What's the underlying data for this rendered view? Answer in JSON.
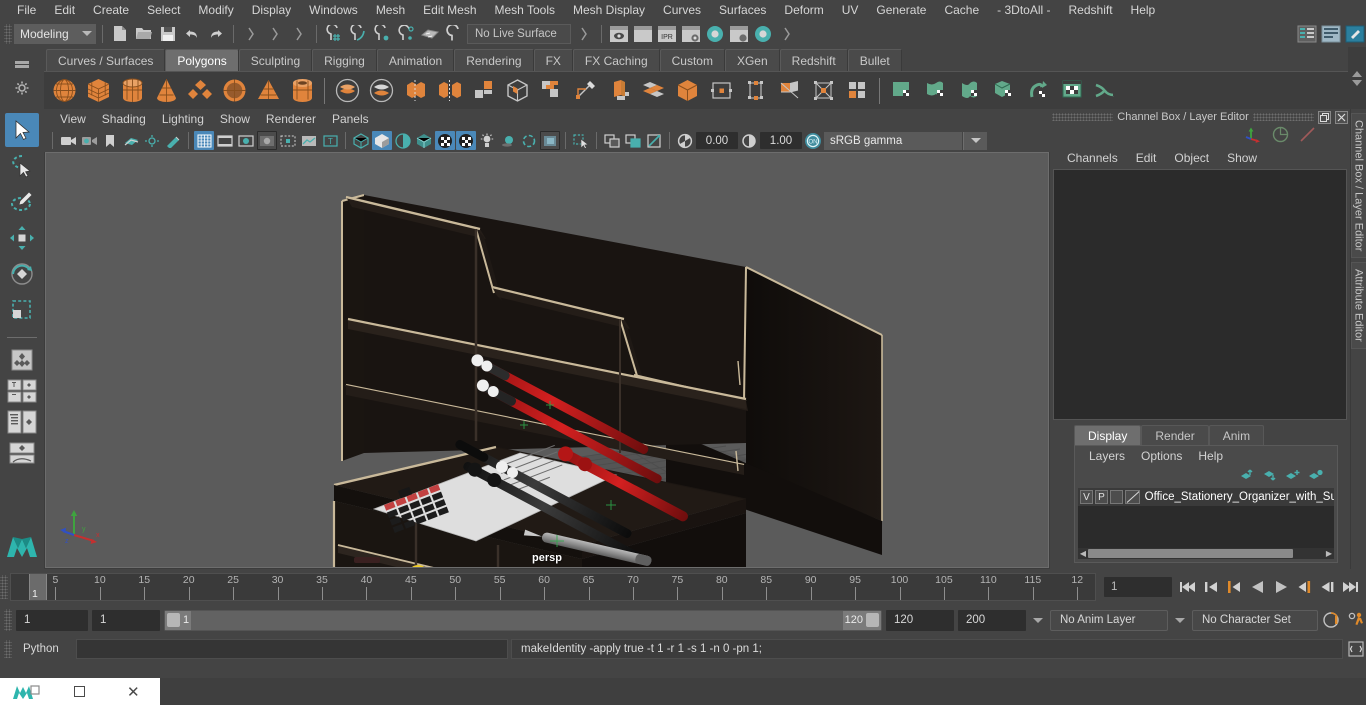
{
  "app": {
    "name": "Autodesk Maya",
    "menubar": [
      "File",
      "Edit",
      "Create",
      "Select",
      "Modify",
      "Display",
      "Windows",
      "Mesh",
      "Edit Mesh",
      "Mesh Tools",
      "Mesh Display",
      "Curves",
      "Surfaces",
      "Deform",
      "UV",
      "Generate",
      "Cache",
      "- 3DtoAll -",
      "Redshift",
      "Help"
    ]
  },
  "statusline": {
    "menuset": "Modeling",
    "live_surface": "No Live Surface",
    "icons": [
      "new-scene-icon",
      "open-scene-icon",
      "save-scene-icon",
      "undo-icon",
      "redo-icon",
      "select-by-hierarchy-icon",
      "select-by-object-icon",
      "select-by-component-icon",
      "snap-to-grid-icon",
      "snap-to-curve-icon",
      "snap-to-point-icon",
      "snap-to-projected-center-icon",
      "snap-to-view-plane-icon",
      "make-live-icon",
      "render-view-icon",
      "render-current-frame-icon",
      "ipr-render-icon",
      "render-settings-icon",
      "hypershade-icon",
      "render-setup-icon",
      "rendering-flags-icon"
    ]
  },
  "shelf": {
    "tabs": [
      "Curves / Surfaces",
      "Polygons",
      "Sculpting",
      "Rigging",
      "Animation",
      "Rendering",
      "FX",
      "FX Caching",
      "Custom",
      "XGen",
      "Redshift",
      "Bullet"
    ],
    "active_tab": "Polygons",
    "accent_orange": "#e0843c",
    "accent_green": "#62a98a",
    "items": [
      {
        "name": "poly-sphere-icon",
        "color": "orange"
      },
      {
        "name": "poly-cube-icon",
        "color": "orange"
      },
      {
        "name": "poly-cylinder-icon",
        "color": "orange"
      },
      {
        "name": "poly-cone-icon",
        "color": "orange"
      },
      {
        "name": "poly-plane-icon",
        "color": "orange"
      },
      {
        "name": "poly-torus-icon",
        "color": "orange"
      },
      {
        "name": "poly-pyramid-icon",
        "color": "orange"
      },
      {
        "name": "poly-pipe-icon",
        "color": "orange"
      },
      {
        "name": "boolean-union-icon",
        "color": "orange"
      },
      {
        "name": "boolean-difference-icon",
        "color": "orange"
      },
      {
        "name": "combine-icon",
        "color": "orange"
      },
      {
        "name": "separate-icon",
        "color": "orange"
      },
      {
        "name": "smooth-icon",
        "color": "gray"
      },
      {
        "name": "reduce-icon",
        "color": "gray"
      },
      {
        "name": "multi-cut-icon",
        "color": "gray"
      },
      {
        "name": "extrude-icon",
        "color": "orange"
      },
      {
        "name": "bevel-icon",
        "color": "gray"
      },
      {
        "name": "bridge-icon",
        "color": "orange"
      },
      {
        "name": "merge-icon",
        "color": "gray"
      },
      {
        "name": "append-polygon-icon",
        "color": "orange"
      },
      {
        "name": "wedge-icon",
        "color": "orange"
      },
      {
        "name": "poke-face-icon",
        "color": "orange"
      },
      {
        "name": "quad-draw-icon",
        "color": "gray"
      },
      {
        "name": "uv-editor-icon",
        "color": "green"
      },
      {
        "name": "uv-planar-icon",
        "color": "green"
      },
      {
        "name": "uv-cylindrical-icon",
        "color": "green"
      },
      {
        "name": "uv-automatic-icon",
        "color": "green"
      },
      {
        "name": "uv-unfold-icon",
        "color": "green"
      },
      {
        "name": "uv-layout-icon",
        "color": "green"
      },
      {
        "name": "uv-snapshot-icon",
        "color": "green"
      }
    ]
  },
  "toolbox": {
    "items": [
      {
        "name": "select-tool",
        "selected": true
      },
      {
        "name": "lasso-select-tool",
        "selected": false
      },
      {
        "name": "paint-select-tool",
        "selected": false
      },
      {
        "name": "move-tool",
        "selected": false
      },
      {
        "name": "rotate-tool",
        "selected": false
      },
      {
        "name": "scale-tool",
        "selected": false
      },
      {
        "name": "last-tool-used",
        "selected": false
      },
      {
        "name": "four-view-layout",
        "selected": false
      },
      {
        "name": "persp-outliner-layout",
        "selected": false
      },
      {
        "name": "persp-graph-layout",
        "selected": false
      },
      {
        "name": "maya-logo",
        "selected": false
      }
    ]
  },
  "viewport": {
    "menubar": [
      "View",
      "Shading",
      "Lighting",
      "Show",
      "Renderer",
      "Panels"
    ],
    "camera_label": "persp",
    "toolbar": {
      "exposure": "0.00",
      "gamma": "1.00",
      "color_management": "sRGB gamma",
      "icons": [
        "select-camera-icon",
        "camera-attributes-icon",
        "bookmark-icon",
        "image-plane-icon",
        "two-d-pan-zoom-icon",
        "grease-pencil-icon",
        "grid-toggle-icon",
        "film-gate-icon",
        "resolution-gate-icon",
        "gate-mask-icon",
        "film-origin-icon",
        "safe-action-icon",
        "hud-text-icon",
        "wireframe-icon",
        "smooth-shade-icon",
        "shaded-wireframe-icon",
        "use-default-material-icon",
        "textured-icon",
        "use-all-lights-icon",
        "shadows-icon",
        "screen-space-ao-icon",
        "motion-blur-icon",
        "multisample-icon",
        "depth-of-field-icon",
        "xray-icon",
        "isolate-select-icon",
        "xray-joints-icon",
        "xray-active-components-icon",
        "exposure-icon",
        "gamma-icon",
        "color-management-icon"
      ]
    }
  },
  "right_panel": {
    "title": "Channel Box / Layer Editor",
    "restore_icon": "restore-window-icon",
    "close_icon": "close-window-icon",
    "header_icons": [
      "channel-box-axis-icon",
      "channel-box-dial-icon",
      "attribute-editor-icon"
    ],
    "menus": [
      "Channels",
      "Edit",
      "Object",
      "Show"
    ],
    "vertical_tabs": [
      "Channel Box / Layer Editor",
      "Attribute Editor"
    ],
    "layer_editor": {
      "tabs": [
        "Display",
        "Render",
        "Anim"
      ],
      "active_tab": "Display",
      "menus": [
        "Layers",
        "Options",
        "Help"
      ],
      "buttons": [
        "move-layer-up-icon",
        "move-layer-down-icon",
        "new-layer-icon",
        "new-layer-from-selected-icon"
      ],
      "layers": [
        {
          "visibility": "V",
          "playback": "P",
          "color_swatch": "",
          "name": "Office_Stationery_Organizer_with_Suppl"
        }
      ]
    }
  },
  "time_slider": {
    "tick_labels": [
      "5",
      "10",
      "15",
      "20",
      "25",
      "30",
      "35",
      "40",
      "45",
      "50",
      "55",
      "60",
      "65",
      "70",
      "75",
      "80",
      "85",
      "90",
      "95",
      "100",
      "105",
      "110",
      "115",
      "12"
    ],
    "current_frame_marker": "1",
    "current_frame_field": "1",
    "playback_buttons": [
      "go-to-start-icon",
      "step-back-keyframe-icon",
      "step-back-frame-icon",
      "play-backwards-icon",
      "play-forwards-icon",
      "step-forward-frame-icon",
      "step-forward-keyframe-icon",
      "go-to-end-icon"
    ]
  },
  "range_slider": {
    "anim_start": "1",
    "range_start": "1",
    "range_bar_start": "1",
    "range_bar_end": "120",
    "range_end": "120",
    "anim_end": "200",
    "anim_layer": "No Anim Layer",
    "character_set": "No Character Set",
    "icons": [
      "auto-keyframe-icon",
      "animation-preferences-icon"
    ]
  },
  "command_line": {
    "language": "Python",
    "input_value": "",
    "output": "makeIdentity -apply true -t 1 -r 1 -s 1 -n 0 -pn 1;",
    "script_editor_icon": "script-editor-icon"
  },
  "taskbar": {
    "app_icon": "maya-app-icon",
    "restore_label": "restore-icon",
    "maximize_label": "maximize-icon",
    "close_label": "close-icon"
  },
  "colors": {
    "bg": "#444444",
    "panel": "#3b3b3b",
    "accent_blue": "#4a88b8",
    "accent_teal": "#49b0ae",
    "accent_orange": "#e0843c",
    "viewport_bg": "#5b5b5b",
    "text": "#cfcfcf"
  }
}
